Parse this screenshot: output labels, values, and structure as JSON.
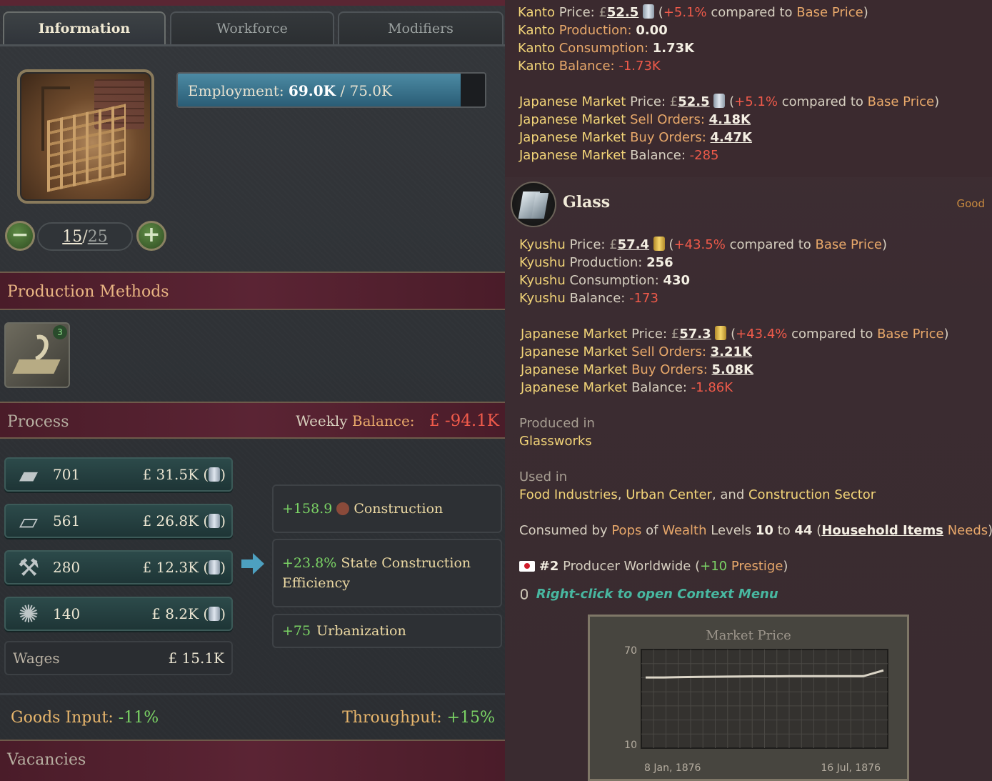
{
  "tabs": [
    "Information",
    "Workforce",
    "Modifiers"
  ],
  "employment": {
    "label": "Employment:",
    "current": "69.0K",
    "max": "/ 75.0K",
    "fill_fraction": 0.92
  },
  "level": {
    "current": "15",
    "sep": "/",
    "max": "25",
    "minus": "−",
    "plus": "+"
  },
  "production_methods": {
    "title": "Production Methods",
    "badge": "3"
  },
  "process": {
    "title": "Process",
    "weekly_label": "Weekly",
    "balance_label": "Balance:",
    "balance_value": "£ -94.1K",
    "inputs": [
      {
        "icon": "steel-icon",
        "qty": "701",
        "cost": "£ 31.5K ("
      },
      {
        "icon": "glass-icon",
        "qty": "561",
        "cost": "£ 26.8K ("
      },
      {
        "icon": "tools-icon",
        "qty": "280",
        "cost": "£ 12.3K ("
      },
      {
        "icon": "explosives-icon",
        "qty": "140",
        "cost": "£ 8.2K ("
      }
    ],
    "close_paren": ")",
    "wages_label": "Wages",
    "wages_value": "£ 15.1K",
    "outputs": [
      {
        "value": "+158.9",
        "label": "Construction"
      },
      {
        "value": "+23.8%",
        "label": "State Construction Efficiency"
      },
      {
        "value": "+75",
        "label": "Urbanization"
      }
    ]
  },
  "goods_input": {
    "label": "Goods Input:",
    "value": "-11%"
  },
  "throughput": {
    "label": "Throughput:",
    "value": "+15%"
  },
  "vacancies": {
    "title": "Vacancies"
  },
  "tooltip": {
    "steel": {
      "kanto_price_label": "Kanto",
      "price_word": "Price:",
      "kanto_price": "52.5",
      "kanto_pct": "+5.1%",
      "compared": "compared to",
      "base_price": "Base Price",
      "kanto_prod_label": "Production:",
      "kanto_prod": "0.00",
      "kanto_cons_label": "Consumption:",
      "kanto_cons": "1.73K",
      "kanto_bal_label": "Balance:",
      "kanto_bal": "-1.73K",
      "jp": "Japanese Market",
      "jp_price": "52.5",
      "jp_pct": "+5.1%",
      "sell": "Sell Orders:",
      "sell_val": "4.18K",
      "buy": "Buy Orders:",
      "buy_val": "4.47K",
      "bal": "Balance:",
      "bal_val": "-285"
    },
    "glass": {
      "name": "Glass",
      "tag": "Good",
      "region": "Kyushu",
      "price": "57.4",
      "pct": "+43.5%",
      "prod": "256",
      "cons": "430",
      "bal": "-173",
      "jp_price": "57.3",
      "jp_pct": "+43.4%",
      "sell_val": "3.21K",
      "buy_val": "5.08K",
      "jp_bal": "-1.86K",
      "produced_in_label": "Produced in",
      "produced_in": "Glassworks",
      "used_in_label": "Used in",
      "used_in_1": "Food Industries",
      "used_in_2": "Urban Center",
      "used_in_and": ", and",
      "used_in_3": "Construction Sector",
      "consumed_by": "Consumed by",
      "pops": "Pops",
      "of": "of",
      "wealth": "Wealth",
      "levels": "Levels",
      "lvl_from": "10",
      "to": "to",
      "lvl_to": "44",
      "household": "Household Items",
      "needs": "Needs",
      "rank": "#2",
      "rank_text": "Producer Worldwide",
      "prestige_val": "+10",
      "prestige": "Prestige",
      "context": "Right-click to open Context Menu"
    }
  },
  "chart_data": {
    "type": "line",
    "title": "Market Price",
    "y_ticks": [
      "70",
      "10"
    ],
    "ylim": [
      10,
      70
    ],
    "x_labels": [
      "8 Jan, 1876",
      "16 Jul, 1876"
    ],
    "series": [
      {
        "values": [
          53,
          53,
          53.2,
          53.4,
          53.5,
          53.6,
          53.7,
          53.7,
          53.8,
          53.8,
          53.8,
          53.8,
          53.8,
          57.3
        ]
      }
    ],
    "grid": true
  }
}
